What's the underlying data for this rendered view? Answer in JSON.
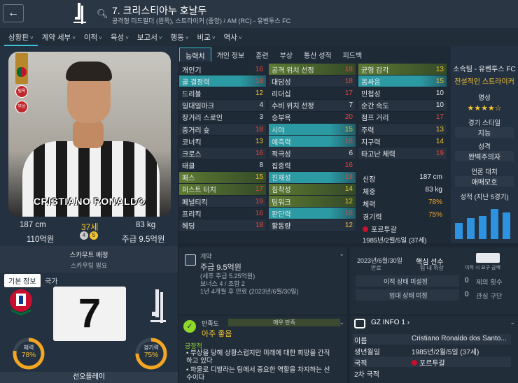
{
  "header": {
    "back_icon": "back-arrow-icon",
    "search_icon": "search-icon",
    "player_name": "7. 크리스티아누 호날두",
    "player_subtitle": "공격형 미드필더 (왼쪽), 스트라이커 (중앙) / AM (RC) - 유벤투스 FC"
  },
  "nav_tabs": [
    {
      "label": "상황판",
      "dropdown": true
    },
    {
      "label": "계약 세부",
      "dropdown": true
    },
    {
      "label": "이적",
      "dropdown": true
    },
    {
      "label": "육성",
      "dropdown": true
    },
    {
      "label": "보고서",
      "dropdown": true
    },
    {
      "label": "행동",
      "dropdown": true
    },
    {
      "label": "비교",
      "dropdown": true
    },
    {
      "label": "역사",
      "dropdown": true
    }
  ],
  "profile": {
    "shirt_name": "CRISTIANO RONALDO",
    "badge_1": "팀옥",
    "badge_2": "부상",
    "height": "187 cm",
    "age": "37세",
    "weight": "83 kg",
    "value": "110억원",
    "wage": "주급 9.5억원",
    "ability_left": "4",
    "ability_right": "5",
    "scout_assign": "스카우트 배정",
    "scout_needed": "스카우팅 필요"
  },
  "basic_info": {
    "tab_basic": "기본 정보",
    "tab_nation": "국가",
    "shirt_number": "7",
    "stamina_label": "체력",
    "stamina_value": "78%",
    "sharpness_label": "경기력",
    "sharpness_value": "75%",
    "play_button": "선오플레이"
  },
  "attr_tabs": [
    "능력치",
    "개인 정보",
    "훈련",
    "부상",
    "통산 성적",
    "피드백"
  ],
  "attributes": {
    "technical": [
      {
        "name": "개인기",
        "value": "16",
        "color": "#e8473a",
        "hl": ""
      },
      {
        "name": "골 결정력",
        "value": "18",
        "color": "#e8473a",
        "hl": "teal"
      },
      {
        "name": "드리블",
        "value": "12",
        "color": "#f4c430",
        "hl": ""
      },
      {
        "name": "일대일마크",
        "value": "4",
        "color": "#e6e9ee",
        "hl": ""
      },
      {
        "name": "장거리 스로인",
        "value": "3",
        "color": "#e6e9ee",
        "hl": ""
      },
      {
        "name": "중거리 슛",
        "value": "18",
        "color": "#e8473a",
        "hl": ""
      },
      {
        "name": "코너킥",
        "value": "13",
        "color": "#f4c430",
        "hl": ""
      },
      {
        "name": "크로스",
        "value": "16",
        "color": "#e8473a",
        "hl": ""
      },
      {
        "name": "태클",
        "value": "8",
        "color": "#e6e9ee",
        "hl": ""
      },
      {
        "name": "패스",
        "value": "15",
        "color": "#f4c430",
        "hl": "green"
      },
      {
        "name": "퍼스트 터치",
        "value": "17",
        "color": "#e8473a",
        "hl": "green"
      },
      {
        "name": "페널티킥",
        "value": "19",
        "color": "#e8473a",
        "hl": ""
      },
      {
        "name": "프리킥",
        "value": "16",
        "color": "#e8473a",
        "hl": ""
      },
      {
        "name": "헤딩",
        "value": "18",
        "color": "#e8473a",
        "hl": ""
      }
    ],
    "mental": [
      {
        "name": "공격 위치 선정",
        "value": "18",
        "color": "#e8473a",
        "hl": "green"
      },
      {
        "name": "대담성",
        "value": "18",
        "color": "#e8473a",
        "hl": ""
      },
      {
        "name": "리더십",
        "value": "17",
        "color": "#e8473a",
        "hl": ""
      },
      {
        "name": "수비 위치 선정",
        "value": "7",
        "color": "#e6e9ee",
        "hl": ""
      },
      {
        "name": "승부욕",
        "value": "20",
        "color": "#e8473a",
        "hl": ""
      },
      {
        "name": "시야",
        "value": "15",
        "color": "#f4c430",
        "hl": "teal"
      },
      {
        "name": "예측력",
        "value": "18",
        "color": "#e8473a",
        "hl": "teal"
      },
      {
        "name": "적극성",
        "value": "6",
        "color": "#e6e9ee",
        "hl": ""
      },
      {
        "name": "집중력",
        "value": "16",
        "color": "#e8473a",
        "hl": ""
      },
      {
        "name": "진재성",
        "value": "18",
        "color": "#e8473a",
        "hl": "teal"
      },
      {
        "name": "침착성",
        "value": "14",
        "color": "#f4c430",
        "hl": "green"
      },
      {
        "name": "팀워크",
        "value": "12",
        "color": "#f4c430",
        "hl": "green"
      },
      {
        "name": "판단력",
        "value": "18",
        "color": "#e8473a",
        "hl": "teal"
      },
      {
        "name": "활동량",
        "value": "12",
        "color": "#f4c430",
        "hl": ""
      }
    ],
    "physical": [
      {
        "name": "균형 감각",
        "value": "13",
        "color": "#f4c430",
        "hl": "green"
      },
      {
        "name": "몸싸움",
        "value": "15",
        "color": "#f4c430",
        "hl": "teal"
      },
      {
        "name": "민첩성",
        "value": "10",
        "color": "#e6e9ee",
        "hl": ""
      },
      {
        "name": "순간 속도",
        "value": "10",
        "color": "#e6e9ee",
        "hl": ""
      },
      {
        "name": "점프 거리",
        "value": "17",
        "color": "#e8473a",
        "hl": ""
      },
      {
        "name": "주력",
        "value": "13",
        "color": "#f4c430",
        "hl": ""
      },
      {
        "name": "지구력",
        "value": "14",
        "color": "#f4c430",
        "hl": ""
      },
      {
        "name": "타고난 체력",
        "value": "19",
        "color": "#e8473a",
        "hl": ""
      }
    ]
  },
  "phys_summary": {
    "height_label": "신장",
    "height_value": "187 cm",
    "weight_label": "체중",
    "weight_value": "83 kg",
    "stamina_label": "체력",
    "stamina_value": "78%",
    "sharp_label": "경기력",
    "sharp_value": "75%",
    "nation": "포르투갈",
    "dob": "1985년/2월/5일 (37세)"
  },
  "right_panel": {
    "club": "소속팀 - 유벤투스 FC",
    "role": "전설적인 스트라이커",
    "rep_label": "명성",
    "stars": "★★★★☆",
    "style_label": "경기 스타일",
    "style_value": "지능",
    "personality_label": "성격",
    "personality_value": "완벽주의자",
    "media_label": "언론 대처",
    "media_value": "애매모호",
    "form_label": "성적 (지난 5경기)",
    "form_bars": [
      0.42,
      0.55,
      0.62,
      0.8,
      0.7
    ]
  },
  "contract": {
    "label": "계약",
    "wage": "주급 9.5억원",
    "wage_detail": "(세후 주급 5.25억원)",
    "bonus": "보너스 4 / 조항 2",
    "expiry": "1년 4개월 후 만료 (2023년/6월/30일)"
  },
  "core": {
    "date": "2023년/6월/30일",
    "date_sub": "만료",
    "status": "핵심 선수",
    "status_sub": "팀 내 위상",
    "lock_sub": "이적 시 요구 금액",
    "row1_label": "이적 상태 미설정",
    "row1_num": "0",
    "row1_text": "제의 횟수",
    "row2_label": "임대 상태 미정",
    "row2_num": "0",
    "row2_text": "관심 구단"
  },
  "satisfaction": {
    "label": "만족도",
    "tag": "매우 만족",
    "value": "아주 좋음",
    "sub": "긍정적",
    "bullet1": "부상을 당해 상황스럽지만 미래에 대한 희망을 간직하고 있다",
    "bullet2": "파울로 디발라는 팀에서 중요한 역할을 차지하는 선수이다"
  },
  "gz": {
    "title": "GZ INFO 1",
    "name_label": "이름",
    "name_value": "Cristiano Ronaldo dos Santo...",
    "dob_label": "생년월일",
    "dob_value": "1985년/2월/5일 (37세)",
    "nation_label": "국적",
    "nation_value": "포르투갈",
    "second_label": "2차 국적"
  },
  "colors": {
    "accent": "#39c6d7",
    "high": "#e8473a",
    "mid": "#f4c430",
    "bar": "#2d93e0",
    "teal_row": "#2b9aa2",
    "green_row": "#5d7a32"
  }
}
